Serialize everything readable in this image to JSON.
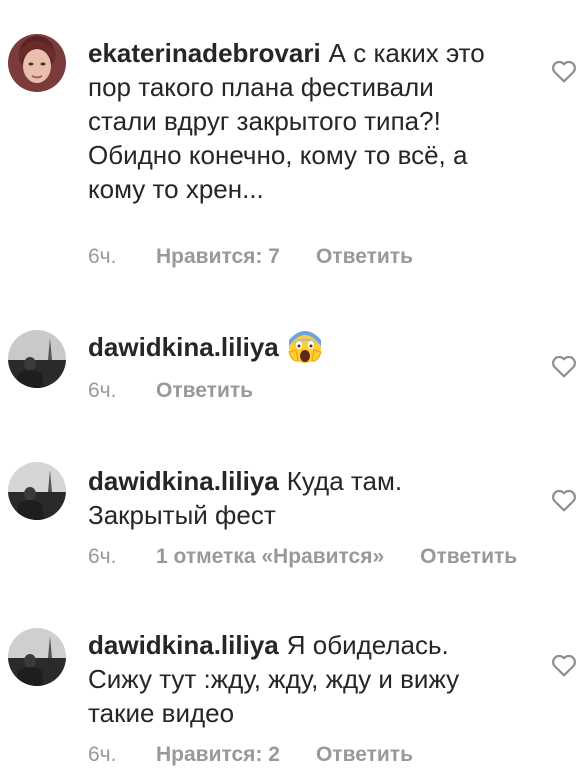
{
  "comments": [
    {
      "username": "ekaterinadebrovari",
      "text": "А  с каких это пор такого  плана фестивали стали вдруг закрытого типа?! Обидно конечно, кому то всё, а кому то хрен...",
      "time": "6ч.",
      "likes": "Нравится: 7",
      "reply": "Ответить"
    },
    {
      "username": "dawidkina.liliya",
      "text": "",
      "emoji": "screaming-face-emoji",
      "time": "6ч.",
      "likes": "",
      "reply": "Ответить"
    },
    {
      "username": "dawidkina.liliya",
      "text": "Куда там. Закрытый фест",
      "time": "6ч.",
      "likes": "1 отметка «Нравится»",
      "reply": "Ответить"
    },
    {
      "username": "dawidkina.liliya",
      "text": "Я обиделась. Сижу тут :жду, жду, жду и вижу такие видео",
      "time": "6ч.",
      "likes": "Нравится: 2",
      "reply": "Ответить"
    }
  ],
  "colors": {
    "text": "#262626",
    "meta": "#999999",
    "heart": "#8e8e8e"
  }
}
